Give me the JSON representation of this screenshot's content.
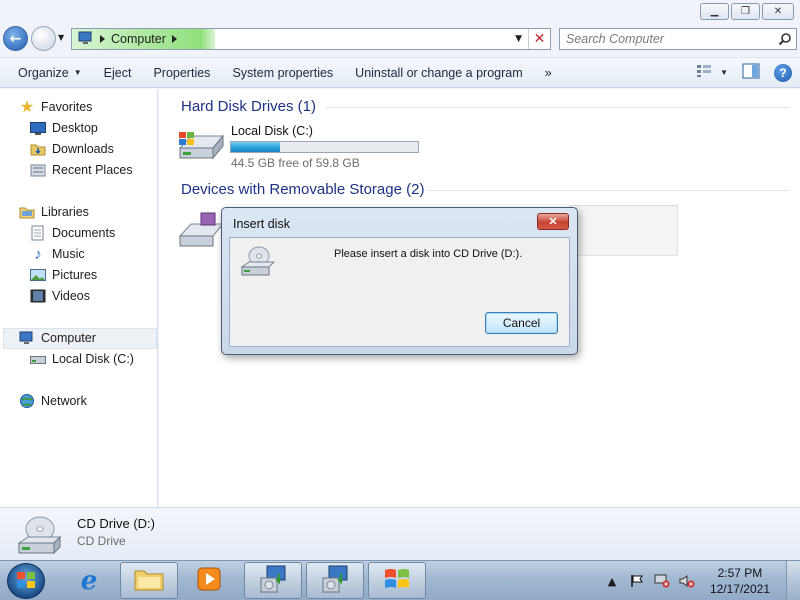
{
  "window": {
    "caption_buttons": [
      "minimize",
      "maximize",
      "close"
    ]
  },
  "address_bar": {
    "location": "Computer",
    "search_placeholder": "Search Computer"
  },
  "toolbar": {
    "items": [
      "Organize",
      "Eject",
      "Properties",
      "System properties",
      "Uninstall or change a program"
    ],
    "more": "»"
  },
  "nav": {
    "favorites": "Favorites",
    "desktop": "Desktop",
    "downloads": "Downloads",
    "recent_places": "Recent Places",
    "libraries": "Libraries",
    "documents": "Documents",
    "music": "Music",
    "pictures": "Pictures",
    "videos": "Videos",
    "computer": "Computer",
    "local_disk": "Local Disk (C:)",
    "network": "Network"
  },
  "content": {
    "hdd_header": "Hard Disk Drives (1)",
    "drive_c": {
      "name": "Local Disk (C:)",
      "free_text": "44.5 GB free of 59.8 GB",
      "used_fraction": 0.26
    },
    "removable_header": "Devices with Removable Storage (2)"
  },
  "details": {
    "name": "CD Drive (D:)",
    "type": "CD Drive"
  },
  "dialog": {
    "title": "Insert disk",
    "close": "✕",
    "message": "Please insert a disk into CD Drive (D:).",
    "cancel": "Cancel"
  },
  "taskbar": {
    "time": "2:57 PM",
    "date": "12/17/2021"
  }
}
